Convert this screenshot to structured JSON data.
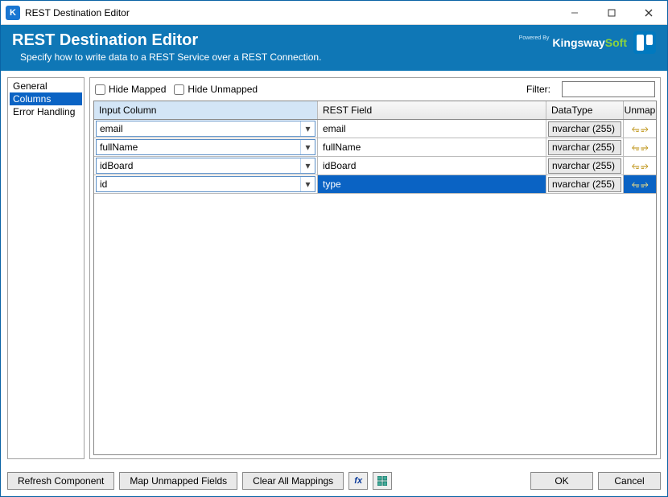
{
  "window": {
    "title": "REST Destination Editor"
  },
  "banner": {
    "heading": "REST Destination Editor",
    "subtitle": "Specify how to write data to a REST Service over a REST Connection.",
    "powered_by": "Powered By",
    "brand_a": "Kingsway",
    "brand_b": "Soft"
  },
  "sidebar": {
    "items": [
      {
        "label": "General",
        "selected": false
      },
      {
        "label": "Columns",
        "selected": true
      },
      {
        "label": "Error Handling",
        "selected": false
      }
    ]
  },
  "toolbar": {
    "hide_mapped_label": "Hide Mapped",
    "hide_unmapped_label": "Hide Unmapped",
    "filter_label": "Filter:",
    "filter_value": ""
  },
  "grid": {
    "headers": {
      "input": "Input Column",
      "rest": "REST Field",
      "type": "DataType",
      "unmap": "Unmap"
    },
    "rows": [
      {
        "input": "email",
        "rest": "email",
        "type": "nvarchar (255)",
        "selected": false
      },
      {
        "input": "fullName",
        "rest": "fullName",
        "type": "nvarchar (255)",
        "selected": false
      },
      {
        "input": "idBoard",
        "rest": "idBoard",
        "type": "nvarchar (255)",
        "selected": false
      },
      {
        "input": "id",
        "rest": "type",
        "type": "nvarchar (255)",
        "selected": true
      }
    ]
  },
  "footer": {
    "refresh": "Refresh Component",
    "map_unmapped": "Map Unmapped Fields",
    "clear_all": "Clear All Mappings",
    "ok": "OK",
    "cancel": "Cancel"
  }
}
